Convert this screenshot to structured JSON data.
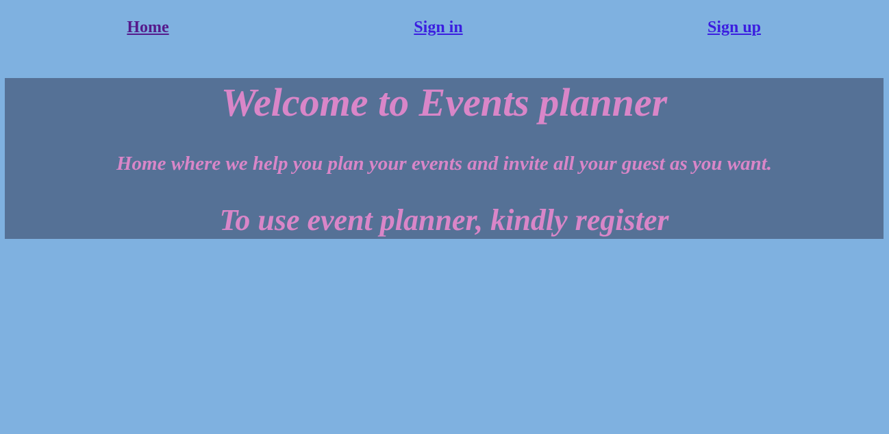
{
  "nav": {
    "home_label": "Home",
    "signin_label": "Sign in",
    "signup_label": "Sign up"
  },
  "banner": {
    "title": "Welcome to Events planner",
    "subtitle": "Home where we help you plan your events and invite all your guest as you want.",
    "cta": "To use event planner, kindly register"
  },
  "colors": {
    "page_background": "#7fb1e0",
    "banner_background": "#557196",
    "banner_text": "#d986c8",
    "link_visited": "#551a8b",
    "link": "#3b1ee0"
  }
}
